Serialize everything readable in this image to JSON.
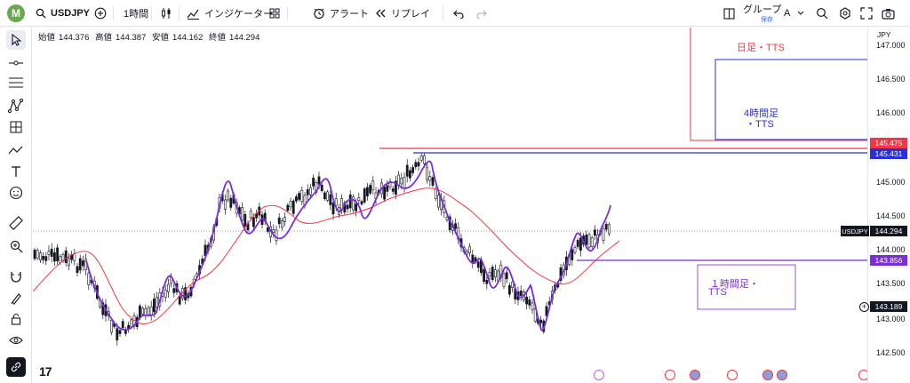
{
  "toolbar": {
    "avatar_letter": "M",
    "symbol": "USDJPY",
    "interval": "1時間",
    "indicators_label": "インジケーター",
    "alert_label": "アラート",
    "replay_label": "リプレイ",
    "group_label": "グループ",
    "group_sub": "保存",
    "layout_letter": "A"
  },
  "ohlc": {
    "open_label": "始値",
    "open": "144.376",
    "high_label": "高値",
    "high": "144.387",
    "low_label": "安値",
    "low": "144.162",
    "close_label": "終値",
    "close": "144.294"
  },
  "axis": {
    "currency": "JPY",
    "ticks": [
      "147.000",
      "146.500",
      "146.000",
      "145.000",
      "144.500",
      "144.000",
      "143.500",
      "143.000",
      "142.500"
    ]
  },
  "price_labels": {
    "red": "145.475",
    "blue": "145.431",
    "symbol_tag": "USDJPY",
    "current": "144.294",
    "purple": "143.856",
    "crosshair": "143.189"
  },
  "annotations": {
    "daily": "日足・TTS",
    "h4_line1": "4時間足",
    "h4_line2": "・TTS",
    "h1_line1": "１時間足・",
    "h1_line2": "TTS"
  },
  "colors": {
    "red_line": "#f23645",
    "blue_line": "#2a2fd6",
    "purple_line": "#7a2fd6",
    "ma_line": "#f23645",
    "bg": "#ffffff"
  },
  "logo": "17"
}
